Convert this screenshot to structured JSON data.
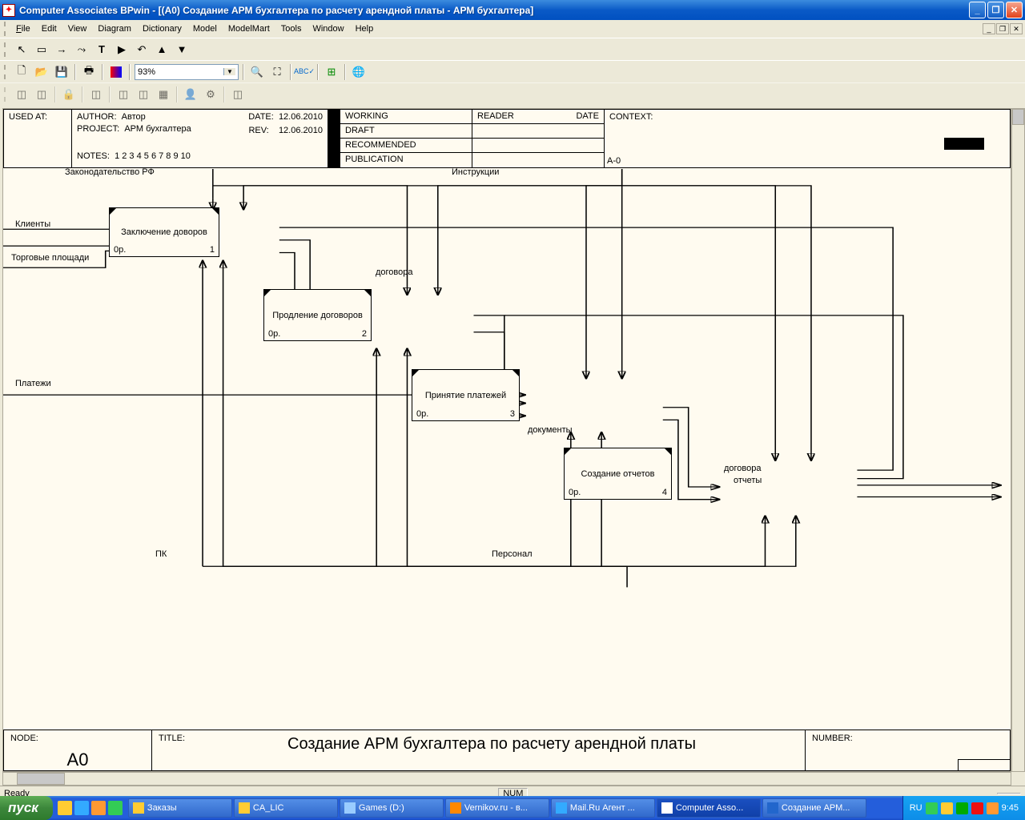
{
  "window": {
    "title": "Computer Associates BPwin - [(A0) Создание АРМ бухгалтера по расчету арендной платы - АРМ бухгалтера]"
  },
  "menu": {
    "file": "File",
    "edit": "Edit",
    "view": "View",
    "diagram": "Diagram",
    "dictionary": "Dictionary",
    "model": "Model",
    "modelmart": "ModelMart",
    "tools": "Tools",
    "window": "Window",
    "help": "Help"
  },
  "toolbar": {
    "zoom": "93%"
  },
  "idef_header": {
    "used_at": "USED AT:",
    "author_label": "AUTHOR:",
    "author": "Автор",
    "project_label": "PROJECT:",
    "project": "АРМ бухгалтера",
    "notes_label": "NOTES:",
    "notes": "1 2 3 4 5 6 7 8 9 10",
    "date_label": "DATE:",
    "date": "12.06.2010",
    "rev_label": "REV:",
    "rev": "12.06.2010",
    "working": "WORKING",
    "draft": "DRAFT",
    "recommended": "RECOMMENDED",
    "publication": "PUBLICATION",
    "reader": "READER",
    "reader_date": "DATE",
    "context": "CONTEXT:",
    "context_id": "A-0"
  },
  "diagram": {
    "inputs": {
      "law": "Законодательство РФ",
      "clients": "Клиенты",
      "areas": "Торговые площади",
      "payments": "Платежи",
      "instructions": "Инструкции"
    },
    "arrows": {
      "contracts": "договора",
      "documents": "документы",
      "contracts_out": "договора",
      "reports_out": "отчеты"
    },
    "mechanisms": {
      "pc": "ПК",
      "staff": "Персонал"
    },
    "boxes": {
      "b1": {
        "title": "Заключение доворов",
        "op": "0р.",
        "num": "1"
      },
      "b2": {
        "title": "Продление договоров",
        "op": "0р.",
        "num": "2"
      },
      "b3": {
        "title": "Принятие платежей",
        "op": "0р.",
        "num": "3"
      },
      "b4": {
        "title": "Создание отчетов",
        "op": "0р.",
        "num": "4"
      }
    }
  },
  "idef_footer": {
    "node_label": "NODE:",
    "node": "A0",
    "title_label": "TITLE:",
    "title": "Создание АРМ бухгалтера по расчету арендной платы",
    "number_label": "NUMBER:"
  },
  "status": {
    "ready": "Ready",
    "num": "NUM"
  },
  "taskbar": {
    "start": "пуск",
    "tasks": [
      "Заказы",
      "CA_LIC",
      "Games (D:)",
      "Vernikov.ru - в...",
      "Mail.Ru Агент ...",
      "Computer Asso...",
      "Создание АРМ..."
    ],
    "lang": "RU",
    "time": "9:45"
  }
}
